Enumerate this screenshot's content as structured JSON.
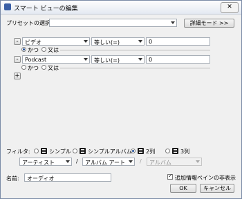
{
  "window": {
    "title": "スマート ビューの編集",
    "close_glyph": "✕"
  },
  "preset": {
    "label": "プリセットの選択:",
    "value": "",
    "details_button": "詳細モード >>"
  },
  "rules": [
    {
      "remove_label": "-",
      "field": "ビデオ",
      "operator": "等しい(=)",
      "value": "0",
      "and_label": "かつ",
      "or_label": "又は",
      "selected": "and"
    },
    {
      "remove_label": "-",
      "field": "Podcast",
      "operator": "等しい(=)",
      "value": "0",
      "and_label": "かつ",
      "or_label": "又は",
      "selected": "and"
    }
  ],
  "add_rule_label": "+",
  "filter": {
    "label": "フィルタ:",
    "options": [
      "シンプル",
      "シンプルアルバム",
      "2列",
      "3列"
    ],
    "selected": "2列",
    "columns": [
      "アーティスト",
      "アルバム アート",
      "アルバム"
    ],
    "separator": "/"
  },
  "name": {
    "label": "名前:",
    "value": "オーディオ"
  },
  "hide_info_pane": {
    "label": "追加情報ペインの非表示",
    "checked": true
  },
  "buttons": {
    "ok": "OK",
    "cancel": "キャンセル"
  },
  "colors": {
    "titlebar": "#e4e9f2",
    "accent": "#1f4e9a"
  }
}
